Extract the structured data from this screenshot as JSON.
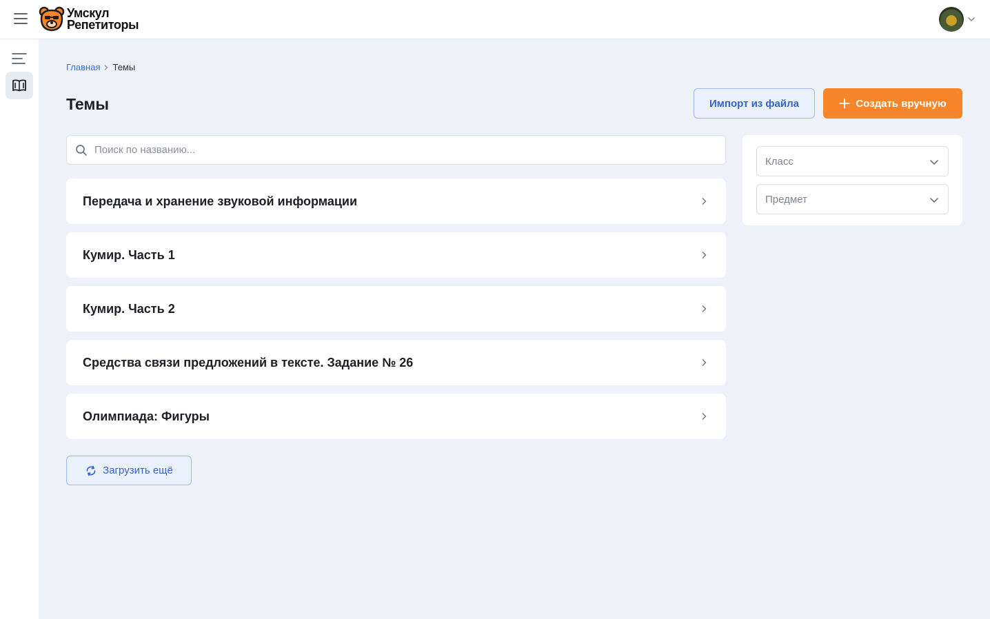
{
  "app": {
    "logo_line1": "Умскул",
    "logo_line2": "Репетиторы"
  },
  "breadcrumb": {
    "home": "Главная",
    "current": "Темы"
  },
  "page": {
    "title": "Темы",
    "import_label": "Импорт из файла",
    "create_label": "Создать вручную"
  },
  "search": {
    "placeholder": "Поиск по названию...",
    "value": ""
  },
  "topics": [
    {
      "label": "Передача и хранение звуковой информации"
    },
    {
      "label": "Кумир. Часть 1"
    },
    {
      "label": "Кумир. Часть 2"
    },
    {
      "label": "Средства связи предложений в тексте. Задание № 26"
    },
    {
      "label": "Олимпиада: Фигуры"
    }
  ],
  "load_more_label": "Загрузить ещё",
  "filters": {
    "class_placeholder": "Класс",
    "subject_placeholder": "Предмет"
  },
  "colors": {
    "accent_orange": "#f7862b",
    "link_blue": "#3a6fd8",
    "background": "#eef2f8"
  },
  "icons": {
    "menu": "hamburger-icon",
    "logo": "bear-logo-icon",
    "list": "list-icon",
    "book": "book-icon",
    "search": "search-icon",
    "chevron_right": "chevron-right-icon",
    "chevron_down": "chevron-down-icon",
    "refresh": "refresh-icon",
    "plus": "plus-icon"
  }
}
